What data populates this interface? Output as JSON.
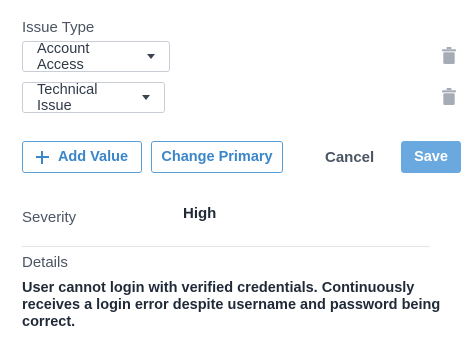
{
  "issue_type": {
    "label": "Issue Type",
    "values": [
      {
        "selected": "Account Access"
      },
      {
        "selected": "Technical Issue"
      }
    ]
  },
  "actions": {
    "add_value": "Add Value",
    "change_primary": "Change Primary",
    "cancel": "Cancel",
    "save": "Save"
  },
  "severity": {
    "label": "Severity",
    "value": "High"
  },
  "details": {
    "label": "Details",
    "text": "User cannot login with verified credentials. Continuously receives a login error despite username and password being correct."
  },
  "colors": {
    "accent": "#3b86c9",
    "primary_button": "#6aa9e0"
  },
  "icons": {
    "delete": "trash-icon",
    "dropdown": "chevron-down-icon",
    "add": "plus-icon"
  }
}
